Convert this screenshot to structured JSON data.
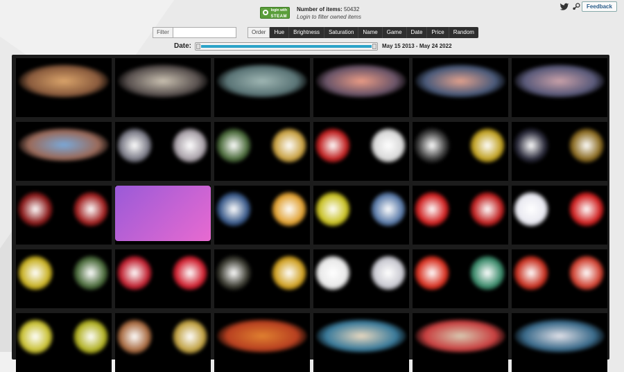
{
  "header": {
    "badge_top": "login with",
    "badge_brand": "STEAM",
    "count_label": "Number of items:",
    "count_value": "50432",
    "login_hint": "Login to filter owned items",
    "feedback_label": "Feedback"
  },
  "filter": {
    "label": "Filter",
    "value": "",
    "placeholder": ""
  },
  "order": {
    "label": "Order",
    "options": [
      "Hue",
      "Brightness",
      "Saturation",
      "Name",
      "Game",
      "Date",
      "Price",
      "Random"
    ]
  },
  "date": {
    "label": "Date:",
    "range_text": "May 15 2013 - May 24 2022",
    "range_start_fraction": 0,
    "range_end_fraction": 1
  },
  "icons": {
    "twitter": "twitter-icon",
    "steam": "steam-icon",
    "search": "magnifier-icon"
  },
  "colors": {
    "accent": "#2ca3c8",
    "steam_green": "#5a9e3a",
    "grid_bg": "#1c1c1c",
    "button_dark": "#2f2f2f"
  },
  "grid": {
    "rows": [
      [
        {
          "kind": "wide",
          "c1": "#8a5b3d",
          "c2": "#d9a36a"
        },
        {
          "kind": "wide",
          "c1": "#5a5250",
          "c2": "#c9c0b0"
        },
        {
          "kind": "wide",
          "c1": "#5a7476",
          "c2": "#9fb6b3"
        },
        {
          "kind": "wide",
          "c1": "#6a5468",
          "c2": "#e99b85"
        },
        {
          "kind": "wide",
          "c1": "#4a5a7a",
          "c2": "#e0a08c"
        },
        {
          "kind": "wide",
          "c1": "#5a5a7a",
          "c2": "#c8a0a8"
        }
      ],
      [
        {
          "kind": "wide",
          "c1": "#9a6a5a",
          "c2": "#7aa8d8"
        },
        {
          "kind": "pair",
          "c1": "#7a7a86",
          "c2": "#a8a0a8"
        },
        {
          "kind": "pair",
          "c1": "#4a6a3a",
          "c2": "#c8a040"
        },
        {
          "kind": "pair",
          "c1": "#c02020",
          "c2": "#d8d8d8"
        },
        {
          "kind": "pair",
          "c1": "#3a3a3a",
          "c2": "#c0a020"
        },
        {
          "kind": "pair",
          "c1": "#2a2a3a",
          "c2": "#8a6a20"
        }
      ],
      [
        {
          "kind": "pair",
          "c1": "#8a1a1a",
          "c2": "#a02020"
        },
        {
          "kind": "square",
          "c1": "#9a5ad8",
          "c2": "#e86ad0"
        },
        {
          "kind": "pair",
          "c1": "#3a5a8a",
          "c2": "#e0a030"
        },
        {
          "kind": "pair",
          "c1": "#c8c020",
          "c2": "#5a7aa8"
        },
        {
          "kind": "pair",
          "c1": "#d02020",
          "c2": "#c02020"
        },
        {
          "kind": "pair",
          "c1": "#e8e8f0",
          "c2": "#d02020"
        }
      ],
      [
        {
          "kind": "pair",
          "c1": "#c8b020",
          "c2": "#4a6a3a"
        },
        {
          "kind": "pair",
          "c1": "#c02030",
          "c2": "#d02030"
        },
        {
          "kind": "pair",
          "c1": "#3a3a30",
          "c2": "#d0a020"
        },
        {
          "kind": "pair",
          "c1": "#e8e8e8",
          "c2": "#c8c8d0"
        },
        {
          "kind": "pair",
          "c1": "#d83020",
          "c2": "#3a8a6a"
        },
        {
          "kind": "pair",
          "c1": "#c83020",
          "c2": "#d04030"
        }
      ],
      [
        {
          "kind": "pair",
          "c1": "#c8c030",
          "c2": "#b0b020"
        },
        {
          "kind": "pair",
          "c1": "#a86a40",
          "c2": "#c0a040"
        },
        {
          "kind": "wide",
          "c1": "#b84020",
          "c2": "#e08030"
        },
        {
          "kind": "wide",
          "c1": "#3a7a9a",
          "c2": "#e8d8c0"
        },
        {
          "kind": "wide",
          "c1": "#c84040",
          "c2": "#d8c8b0"
        },
        {
          "kind": "wide",
          "c1": "#3a6a8a",
          "c2": "#e0e0e8"
        }
      ]
    ]
  }
}
